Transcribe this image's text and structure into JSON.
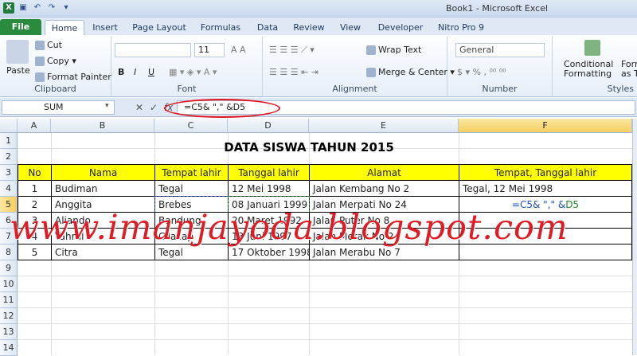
{
  "window": {
    "title": "Book1 - Microsoft Excel"
  },
  "tabs": [
    "File",
    "Home",
    "Insert",
    "Page Layout",
    "Formulas",
    "Data",
    "Review",
    "View",
    "Developer",
    "Nitro Pro 9"
  ],
  "ribbon": {
    "clipboard": {
      "paste": "Paste",
      "cut": "Cut",
      "copy": "Copy",
      "format_painter": "Format Painter",
      "label": "Clipboard"
    },
    "font": {
      "size": "11",
      "bold": "B",
      "italic": "I",
      "underline": "U",
      "label": "Font"
    },
    "alignment": {
      "wrap": "Wrap Text",
      "merge": "Merge & Center",
      "label": "Alignment"
    },
    "number": {
      "format": "General",
      "label": "Number"
    },
    "styles": {
      "conditional": "Conditional",
      "formatting": "Formatting",
      "format_as": "Forma",
      "as_table": "as Tab",
      "label": "Styles"
    }
  },
  "formula_bar": {
    "name_box": "SUM",
    "fx": "fx",
    "formula": "=C5& \",\" &D5"
  },
  "columns": [
    "A",
    "B",
    "C",
    "D",
    "E",
    "F"
  ],
  "rows": [
    "1",
    "2",
    "3",
    "4",
    "5",
    "6",
    "7",
    "8",
    "9",
    "10",
    "11",
    "12",
    "13",
    "14"
  ],
  "sheet": {
    "title": "DATA SISWA TAHUN 2015",
    "headers": [
      "No",
      "Nama",
      "Tempat lahir",
      "Tanggal lahir",
      "Alamat",
      "Tempat, Tanggal lahir"
    ],
    "data": [
      [
        "1",
        "Budiman",
        "Tegal",
        "12 Mei 1998",
        "Jalan Kembang No 2",
        "Tegal, 12 Mei 1998"
      ],
      [
        "2",
        "Anggita",
        "Brebes",
        "08 Januari 1999",
        "Jalan Merpati No 24",
        ""
      ],
      [
        "3",
        "Aliando",
        "Bandung",
        "20 Maret 1992",
        "Jalan Puter No 8",
        ""
      ],
      [
        "4",
        "Yahrul",
        "Cilacap",
        "13 Juni 1997",
        "Jalan Merak No 2",
        ""
      ],
      [
        "5",
        "Citra",
        "Tegal",
        "17 Oktober 1998",
        "Jalan Merabu No 7",
        ""
      ]
    ],
    "editing": {
      "part1": "=C5& \",\" &",
      "part2": "D5",
      "ref1": "C5"
    }
  },
  "watermark": "www.imanjayoda.blogspot.com"
}
